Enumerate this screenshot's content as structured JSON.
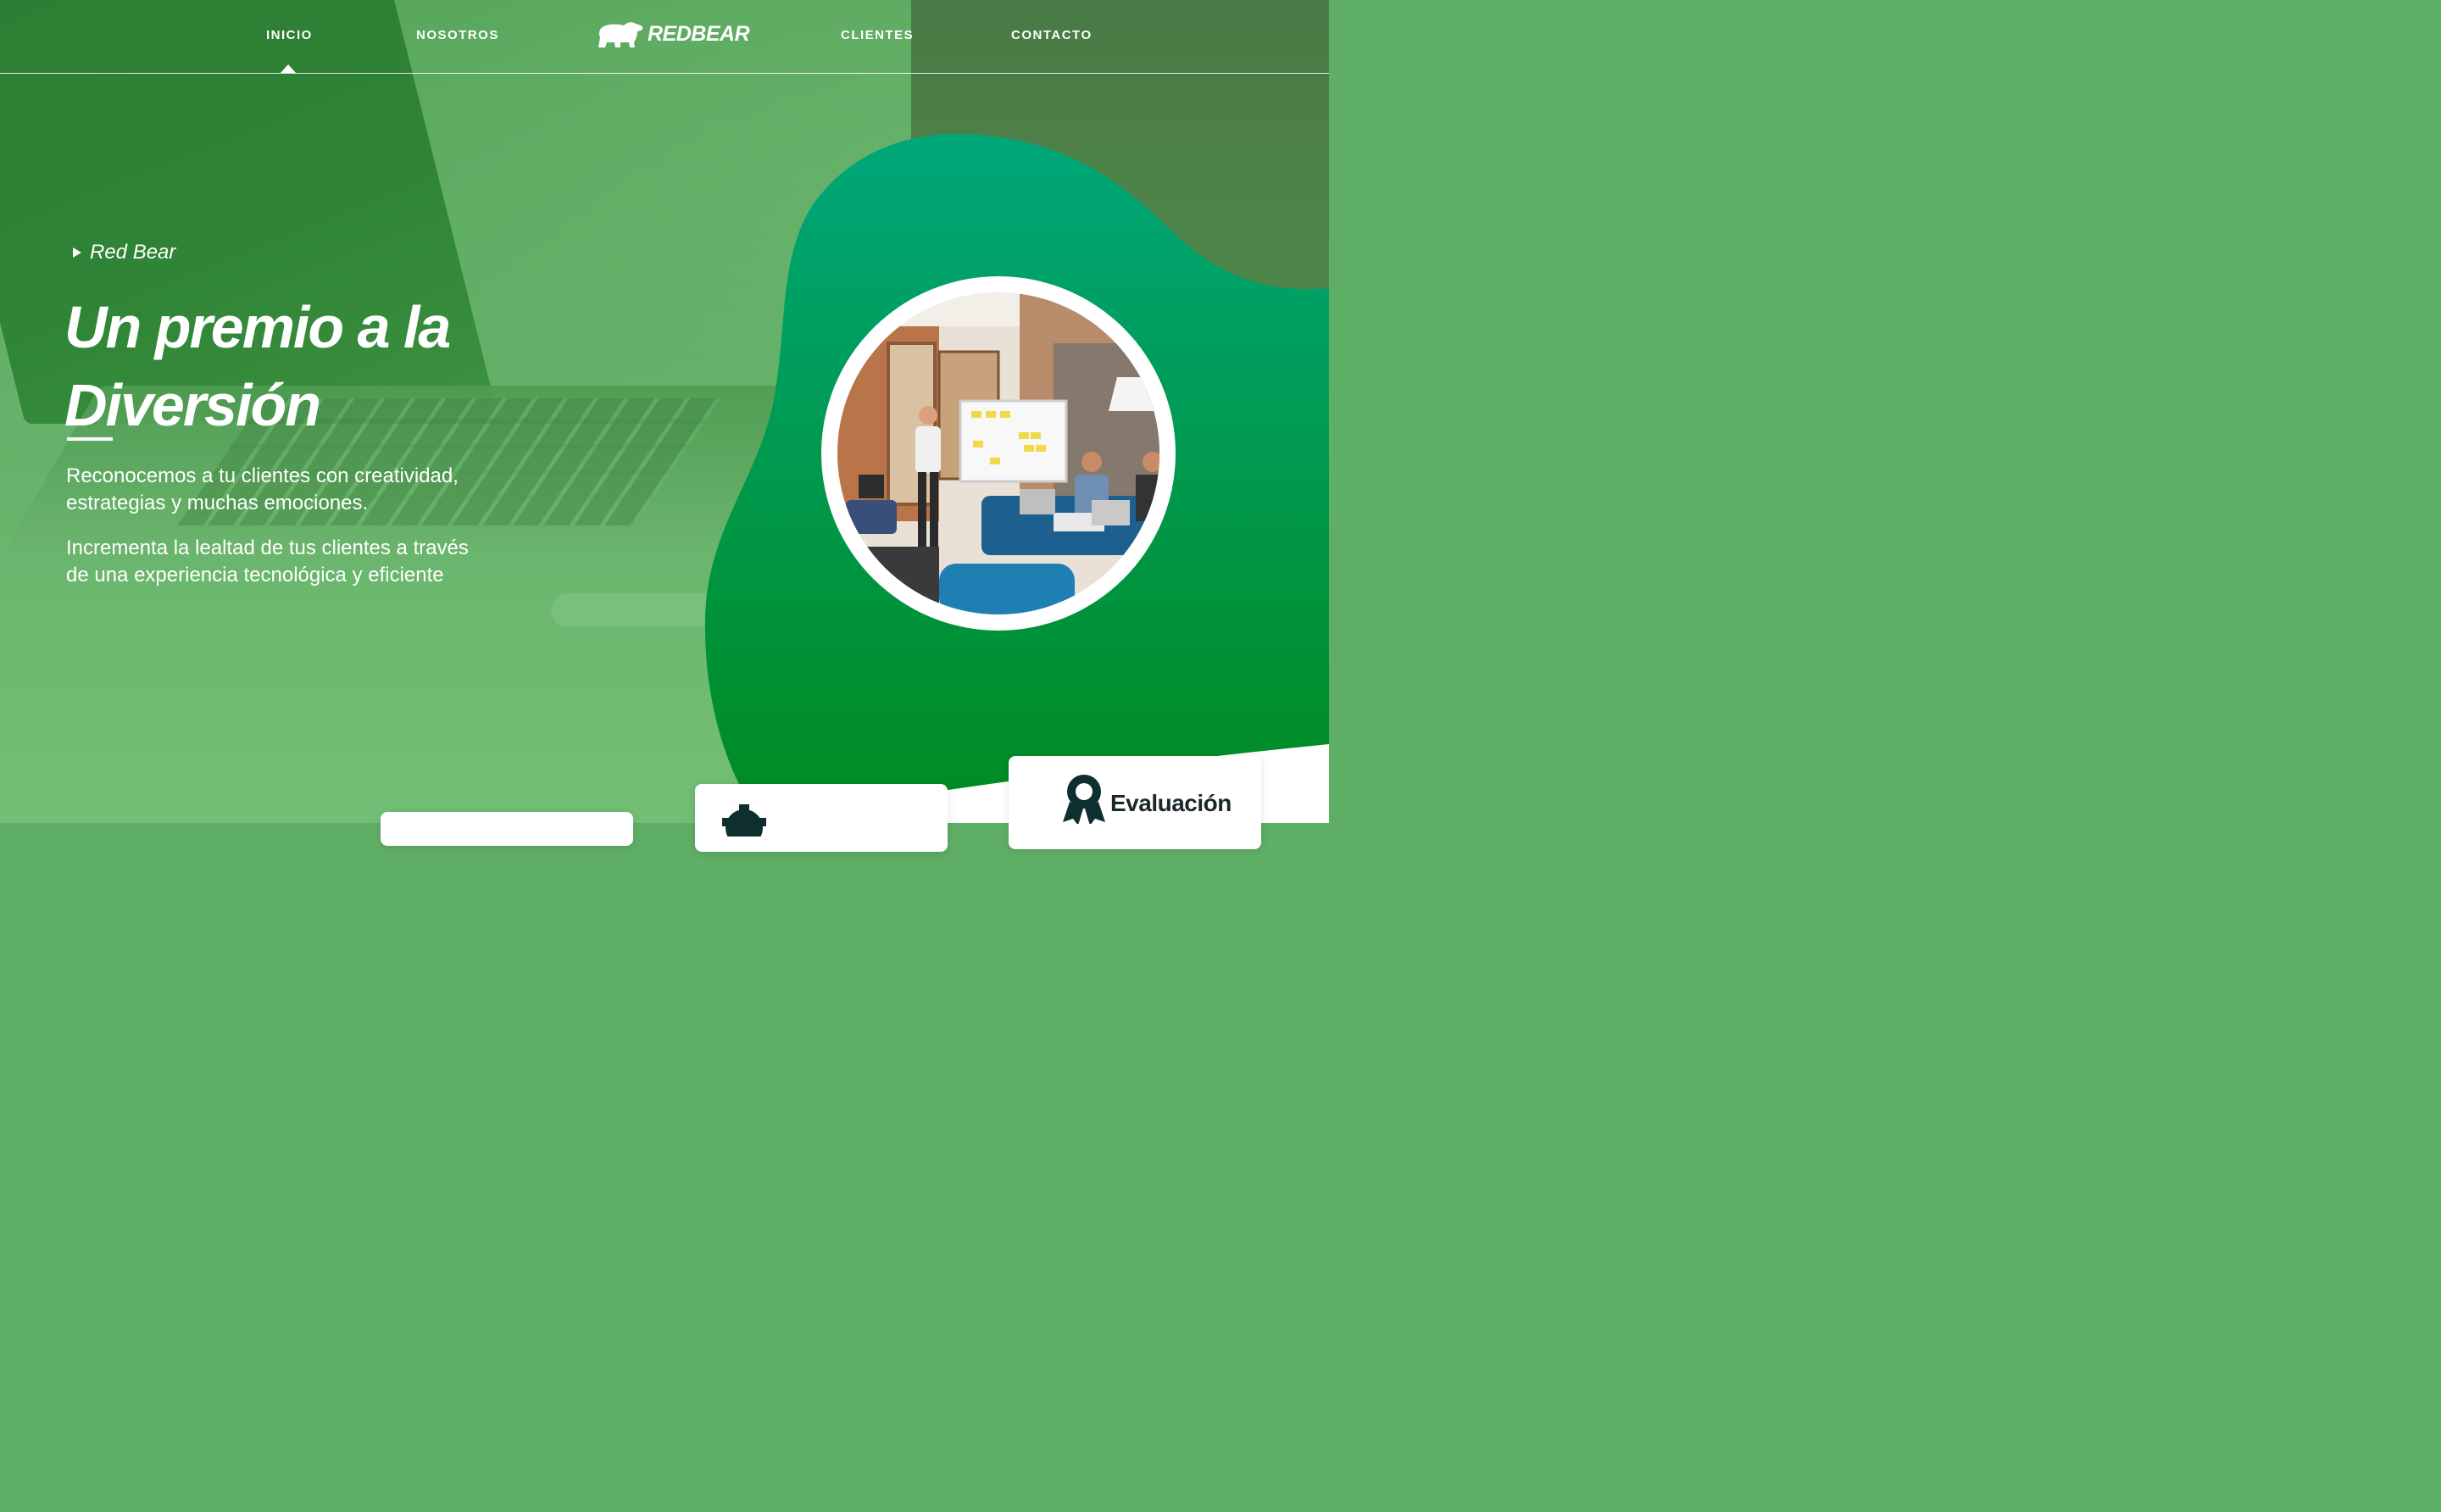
{
  "nav": {
    "links": [
      {
        "label": "INICIO",
        "active": true
      },
      {
        "label": "NOSOTROS",
        "active": false
      },
      {
        "label": "CLIENTES",
        "active": false
      },
      {
        "label": "CONTACTO",
        "active": false
      }
    ],
    "logo_text": "REDBEAR",
    "logo_icon": "bear-icon"
  },
  "hero": {
    "eyebrow": "Red Bear",
    "title_line1": "Un premio a la",
    "title_line2": "Diversión",
    "paragraph1": "Reconocemos a tu clientes con creatividad, estrategias y muchas emociones.",
    "paragraph2": "Incrementa la lealtad de tus clientes a través de una experiencia tecnológica y eficiente"
  },
  "cards": {
    "card3_title": "Evaluación",
    "card3_icon": "award-ribbon-icon",
    "card2_icon": "gear-icon"
  },
  "colors": {
    "blob_top": "#00a77a",
    "blob_bottom": "#008a1f",
    "overlay_green": "#5fae66"
  }
}
